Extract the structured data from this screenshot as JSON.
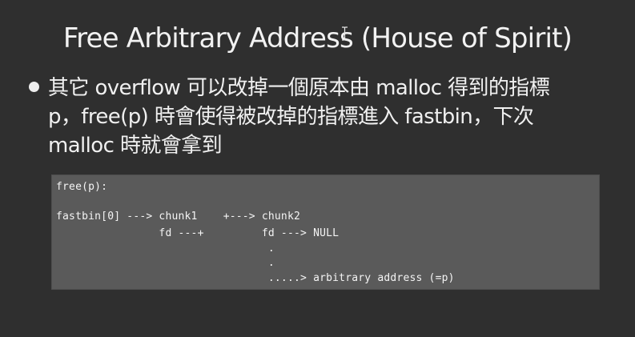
{
  "slide": {
    "title": "Free Arbitrary Address (House of Spirit)",
    "bullet": {
      "lines": [
        "其它 overflow 可以改掉一個原本由 malloc 得到的指標",
        "p，free(p) 時會使得被改掉的指標進入 fastbin，下次",
        "malloc 時就會拿到"
      ]
    },
    "code": {
      "lines": [
        "free(p):",
        "",
        "fastbin[0] ---> chunk1    +---> chunk2",
        "                fd ---+         fd ---> NULL",
        "                                 .",
        "                                 .",
        "                                 .....> arbitrary address (=p)"
      ]
    }
  },
  "icons": {
    "text_cursor": "i-beam-cursor-icon",
    "bullet": "bullet-dot-icon"
  },
  "colors": {
    "background": "#2f2f2f",
    "code_background": "#5a5a5a",
    "text": "#f0f0f0"
  }
}
